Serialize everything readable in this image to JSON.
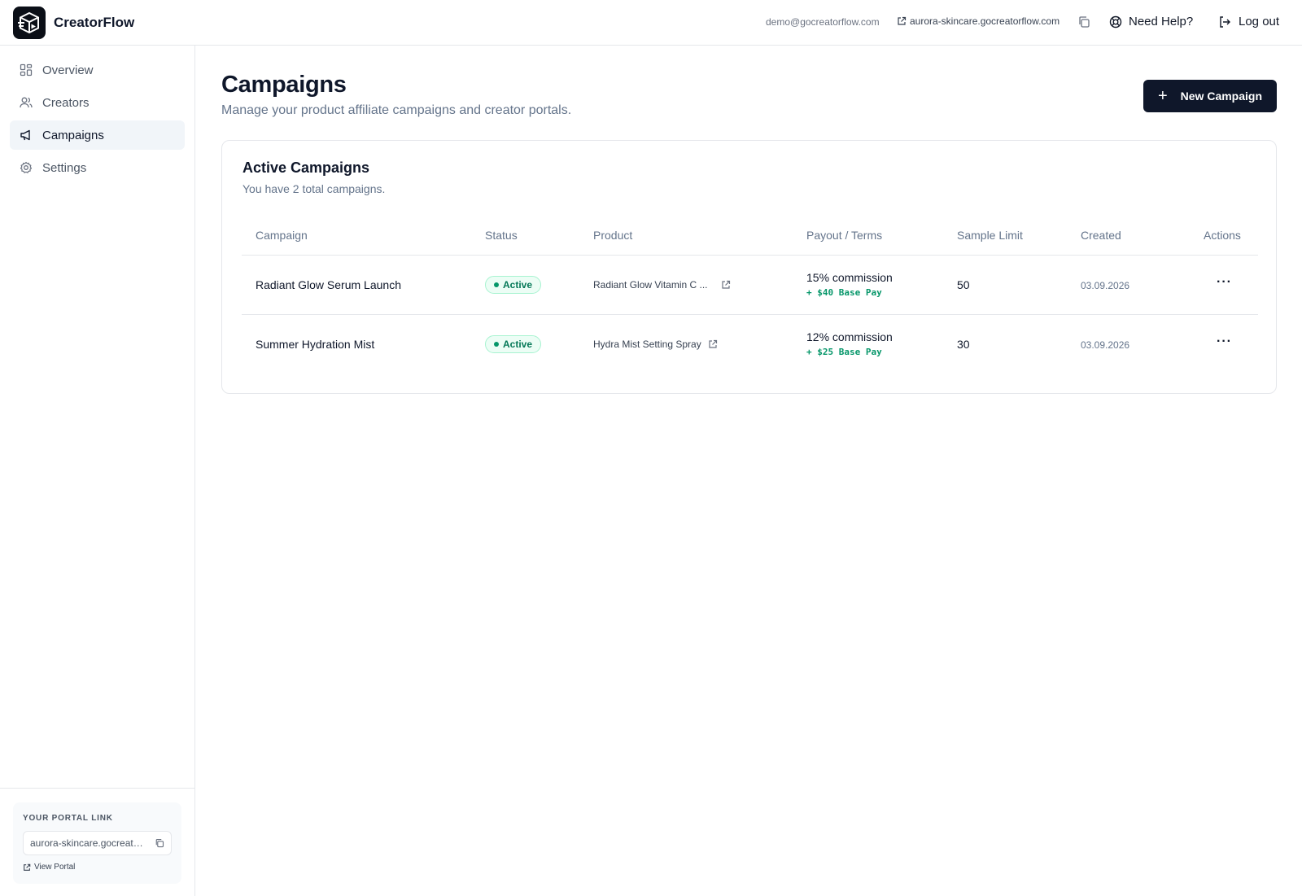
{
  "app": {
    "name": "CreatorFlow",
    "email": "demo@gocreatorflow.com",
    "portal_domain": "aurora-skincare.gocreatorflow.com",
    "help_label": "Need Help?",
    "logout_label": "Log out"
  },
  "sidebar": {
    "items": [
      {
        "label": "Overview",
        "icon": "grid-icon"
      },
      {
        "label": "Creators",
        "icon": "users-icon"
      },
      {
        "label": "Campaigns",
        "icon": "megaphone-icon",
        "active": true
      },
      {
        "label": "Settings",
        "icon": "gear-icon"
      }
    ],
    "portal": {
      "label": "YOUR PORTAL LINK",
      "value": "aurora-skincare.gocreatorflow.com",
      "view_label": "View Portal"
    }
  },
  "page": {
    "title": "Campaigns",
    "subtitle": "Manage your product affiliate campaigns and creator portals.",
    "new_button": "New Campaign"
  },
  "card": {
    "title": "Active Campaigns",
    "subtitle": "You have 2 total campaigns."
  },
  "table": {
    "columns": [
      "Campaign",
      "Status",
      "Product",
      "Payout / Terms",
      "Sample Limit",
      "Created",
      "Actions"
    ],
    "rows": [
      {
        "campaign": "Radiant Glow Serum Launch",
        "status": "Active",
        "product": "Radiant Glow Vitamin C ...",
        "commission": "15% commission",
        "base_pay": "+ $40 Base Pay",
        "sample_limit": "50",
        "created": "03.09.2026",
        "actions": "···"
      },
      {
        "campaign": "Summer Hydration Mist",
        "status": "Active",
        "product": "Hydra Mist Setting Spray",
        "commission": "12% commission",
        "base_pay": "+ $25 Base Pay",
        "sample_limit": "30",
        "created": "03.09.2026",
        "actions": "···"
      }
    ]
  },
  "colors": {
    "primary": "#0f172a",
    "active_badge_bg": "#ecfdf5",
    "active_badge_text": "#047857",
    "base_pay_text": "#059669"
  }
}
